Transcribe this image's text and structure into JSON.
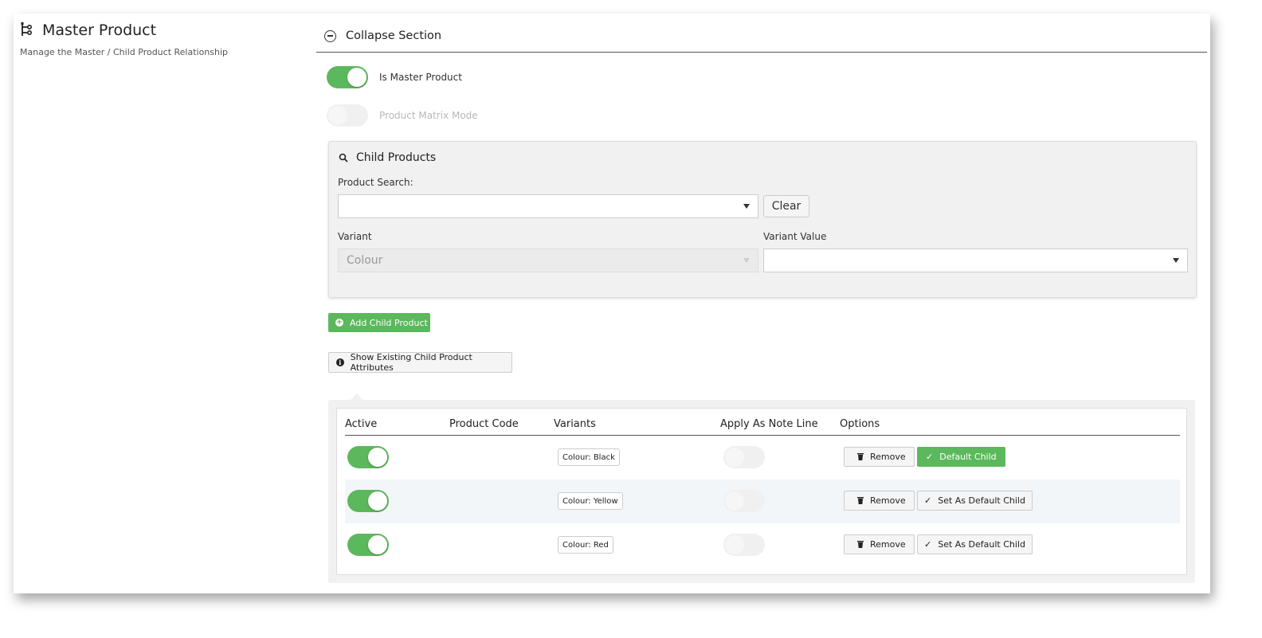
{
  "header": {
    "title": "Master Product",
    "subtitle": "Manage the Master / Child Product Relationship",
    "icon": "hierarchy-icon"
  },
  "section": {
    "collapse_label": "Collapse Section"
  },
  "switches": {
    "is_master_label": "Is Master Product",
    "is_master_on": true,
    "matrix_mode_label": "Product Matrix Mode",
    "matrix_mode_on": false
  },
  "child_products": {
    "heading": "Child Products",
    "product_search_label": "Product Search:",
    "product_search_value": "",
    "clear_label": "Clear",
    "variant_label": "Variant",
    "variant_value": "Colour",
    "variant_value_label": "Variant Value",
    "variant_value_value": ""
  },
  "buttons": {
    "add_child": "Add Child Product",
    "show_attributes": "Show Existing Child Product Attributes"
  },
  "table": {
    "headers": {
      "active": "Active",
      "product_code": "Product Code",
      "variants": "Variants",
      "apply_note": "Apply As Note Line",
      "options": "Options"
    },
    "rows": [
      {
        "active": true,
        "product_code": "",
        "variant": "Colour: Black",
        "apply_note": false,
        "remove": "Remove",
        "default_label": "Default Child",
        "is_default": true
      },
      {
        "active": true,
        "product_code": "",
        "variant": "Colour: Yellow",
        "apply_note": false,
        "remove": "Remove",
        "default_label": "Set As Default Child",
        "is_default": false
      },
      {
        "active": true,
        "product_code": "",
        "variant": "Colour: Red",
        "apply_note": false,
        "remove": "Remove",
        "default_label": "Set As Default Child",
        "is_default": false
      }
    ]
  },
  "colors": {
    "accent_green": "#5cb85c",
    "text_dark": "#222222"
  }
}
